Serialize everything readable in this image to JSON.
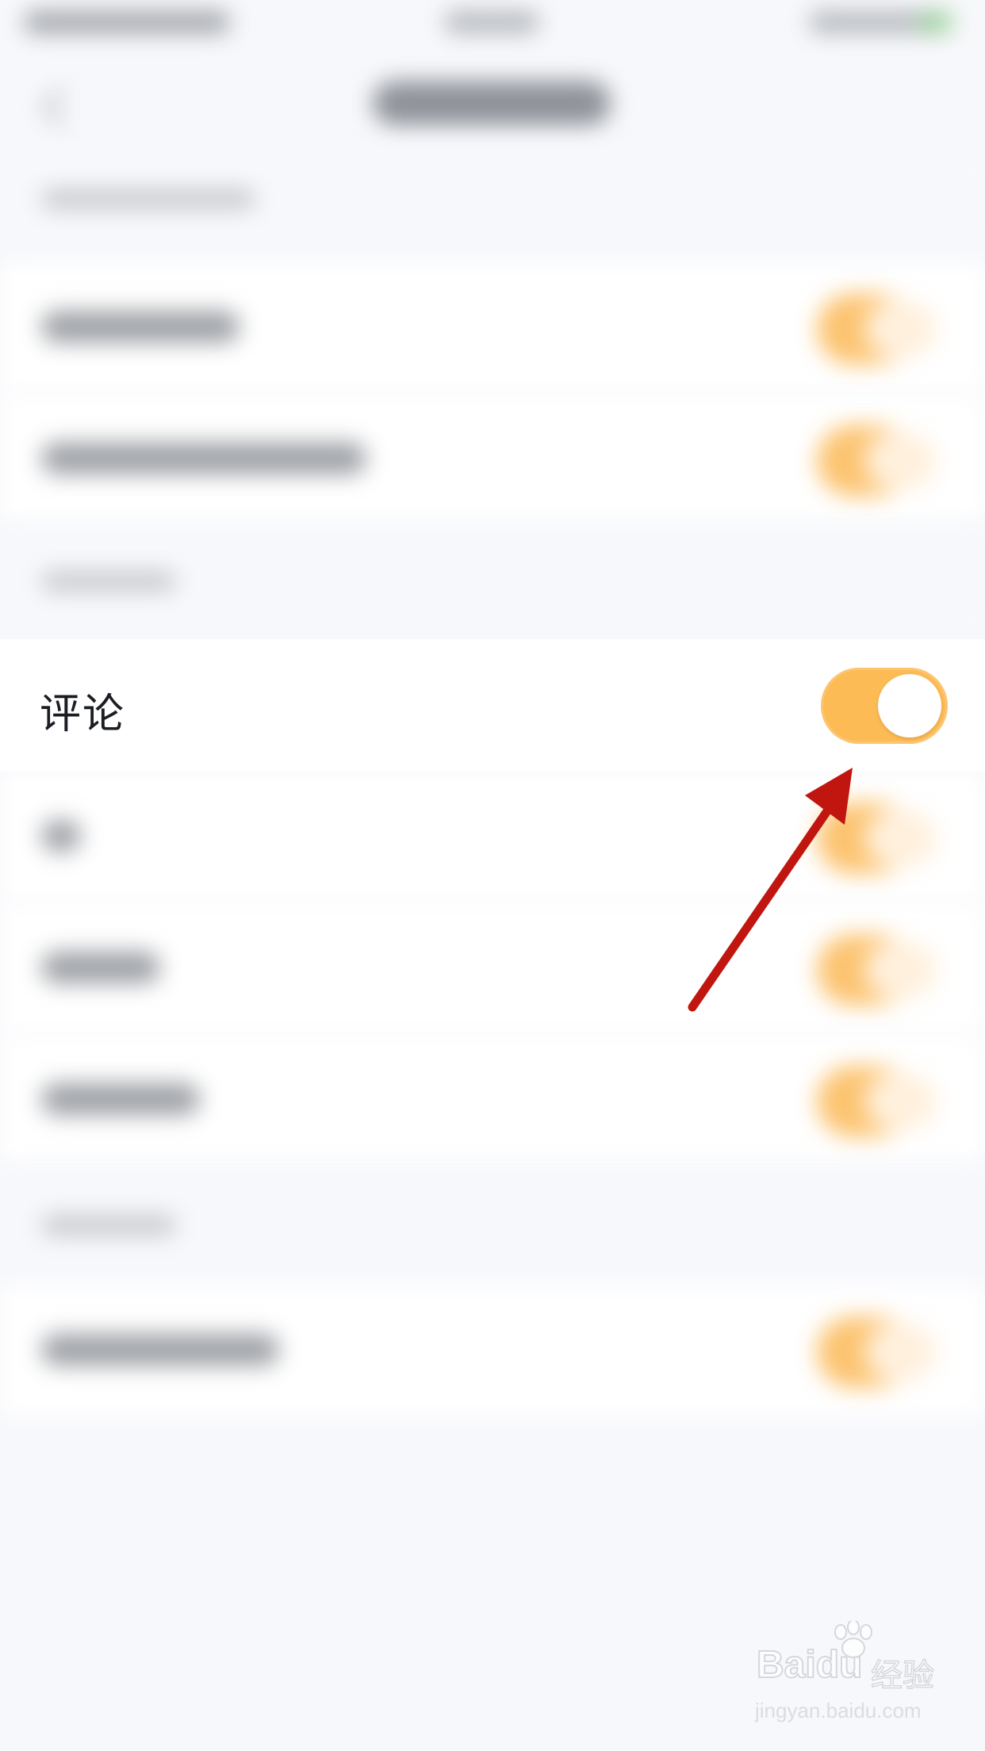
{
  "comment_row": {
    "label": "评论",
    "toggle_on": true
  },
  "colors": {
    "toggle_on": "#fdbb56",
    "annotation_arrow": "#c0160f",
    "background": "#f7f8fb"
  },
  "watermark": {
    "brand": "Bai",
    "brand_suffix": "du",
    "cn": "经验",
    "url": "jingyan.baidu.com"
  },
  "icons": {
    "back": "chevron-left-icon",
    "paw": "baidu-paw-icon"
  }
}
